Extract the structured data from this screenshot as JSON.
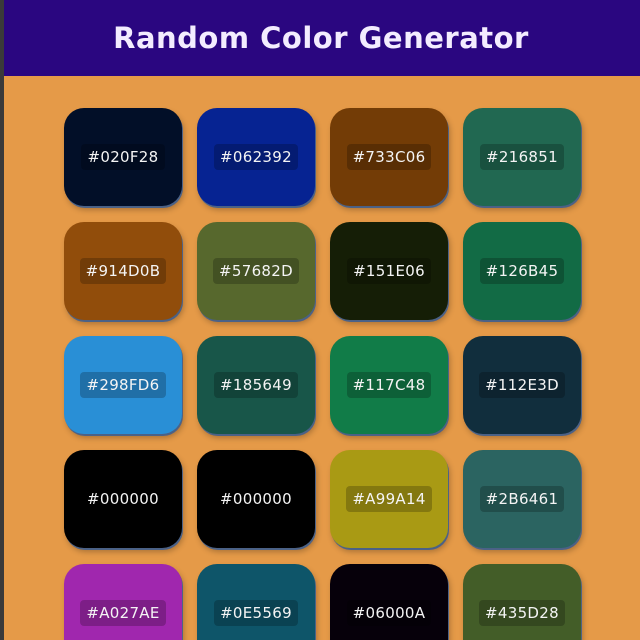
{
  "header": {
    "title": "Random Color Generator"
  },
  "swatches": [
    {
      "hex": "#020F28",
      "color": "#020F28"
    },
    {
      "hex": "#062392",
      "color": "#062392"
    },
    {
      "hex": "#733C06",
      "color": "#733C06"
    },
    {
      "hex": "#216851",
      "color": "#216851"
    },
    {
      "hex": "#914D0B",
      "color": "#914D0B"
    },
    {
      "hex": "#57682D",
      "color": "#57682D"
    },
    {
      "hex": "#151E06",
      "color": "#151E06"
    },
    {
      "hex": "#126B45",
      "color": "#126B45"
    },
    {
      "hex": "#298FD6",
      "color": "#298FD6"
    },
    {
      "hex": "#185649",
      "color": "#185649"
    },
    {
      "hex": "#117C48",
      "color": "#117C48"
    },
    {
      "hex": "#112E3D",
      "color": "#112E3D"
    },
    {
      "hex": "#000000",
      "color": "#000000"
    },
    {
      "hex": "#000000",
      "color": "#000000"
    },
    {
      "hex": "#A99A14",
      "color": "#A99A14"
    },
    {
      "hex": "#2B6461",
      "color": "#2B6461"
    },
    {
      "hex": "#A027AE",
      "color": "#A027AE"
    },
    {
      "hex": "#0E5569",
      "color": "#0E5569"
    },
    {
      "hex": "#06000A",
      "color": "#06000A"
    },
    {
      "hex": "#435D28",
      "color": "#435D28"
    }
  ],
  "colors": {
    "page_background": "#E59A48",
    "header_background": "#2A0680",
    "title_text": "#F3ECFF"
  }
}
